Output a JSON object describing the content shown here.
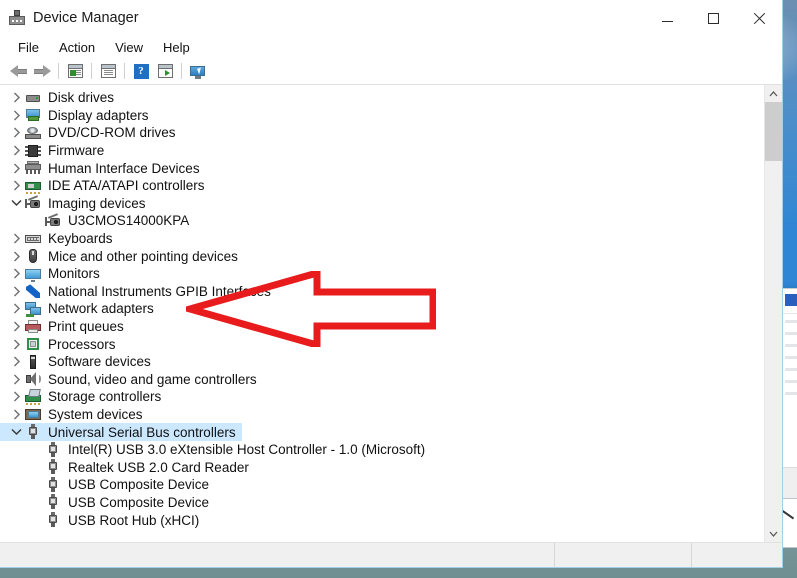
{
  "window": {
    "title": "Device Manager",
    "icon": "device-manager-icon",
    "controls": {
      "minimize": "minimize",
      "maximize": "maximize",
      "close": "close"
    }
  },
  "menubar": {
    "items": [
      {
        "label": "File"
      },
      {
        "label": "Action"
      },
      {
        "label": "View"
      },
      {
        "label": "Help"
      }
    ]
  },
  "toolbar": {
    "buttons": [
      {
        "name": "back-button",
        "icon": "arrow-left-icon"
      },
      {
        "name": "forward-button",
        "icon": "arrow-right-icon"
      },
      {
        "name": "show-hide-console-tree-button",
        "icon": "console-tree-icon"
      },
      {
        "name": "properties-button",
        "icon": "properties-icon"
      },
      {
        "name": "help-button",
        "icon": "help-icon"
      },
      {
        "name": "update-driver-button",
        "icon": "update-driver-icon"
      },
      {
        "name": "scan-for-hardware-changes-button",
        "icon": "scan-hardware-icon"
      }
    ],
    "help_glyph": "?"
  },
  "tree": {
    "items": [
      {
        "label": "Disk drives",
        "depth": 0,
        "expander": "collapsed",
        "icon": "disk-drive-icon",
        "selected": false
      },
      {
        "label": "Display adapters",
        "depth": 0,
        "expander": "collapsed",
        "icon": "display-adapter-icon",
        "selected": false
      },
      {
        "label": "DVD/CD-ROM drives",
        "depth": 0,
        "expander": "collapsed",
        "icon": "dvd-drive-icon",
        "selected": false
      },
      {
        "label": "Firmware",
        "depth": 0,
        "expander": "collapsed",
        "icon": "firmware-icon",
        "selected": false
      },
      {
        "label": "Human Interface Devices",
        "depth": 0,
        "expander": "collapsed",
        "icon": "hid-icon",
        "selected": false
      },
      {
        "label": "IDE ATA/ATAPI controllers",
        "depth": 0,
        "expander": "collapsed",
        "icon": "ide-controller-icon",
        "selected": false
      },
      {
        "label": "Imaging devices",
        "depth": 0,
        "expander": "expanded",
        "icon": "camera-icon",
        "selected": false
      },
      {
        "label": "U3CMOS14000KPA",
        "depth": 1,
        "expander": "none",
        "icon": "camera-icon",
        "selected": false
      },
      {
        "label": "Keyboards",
        "depth": 0,
        "expander": "collapsed",
        "icon": "keyboard-icon",
        "selected": false
      },
      {
        "label": "Mice and other pointing devices",
        "depth": 0,
        "expander": "collapsed",
        "icon": "mouse-icon",
        "selected": false
      },
      {
        "label": "Monitors",
        "depth": 0,
        "expander": "collapsed",
        "icon": "monitor-icon",
        "selected": false
      },
      {
        "label": "National Instruments GPIB Interfaces",
        "depth": 0,
        "expander": "collapsed",
        "icon": "national-instruments-icon",
        "selected": false
      },
      {
        "label": "Network adapters",
        "depth": 0,
        "expander": "collapsed",
        "icon": "network-adapter-icon",
        "selected": false
      },
      {
        "label": "Print queues",
        "depth": 0,
        "expander": "collapsed",
        "icon": "printer-icon",
        "selected": false
      },
      {
        "label": "Processors",
        "depth": 0,
        "expander": "collapsed",
        "icon": "processor-icon",
        "selected": false
      },
      {
        "label": "Software devices",
        "depth": 0,
        "expander": "collapsed",
        "icon": "software-device-icon",
        "selected": false
      },
      {
        "label": "Sound, video and game controllers",
        "depth": 0,
        "expander": "collapsed",
        "icon": "sound-icon",
        "selected": false
      },
      {
        "label": "Storage controllers",
        "depth": 0,
        "expander": "collapsed",
        "icon": "storage-controller-icon",
        "selected": false
      },
      {
        "label": "System devices",
        "depth": 0,
        "expander": "collapsed",
        "icon": "system-device-icon",
        "selected": false
      },
      {
        "label": "Universal Serial Bus controllers",
        "depth": 0,
        "expander": "expanded",
        "icon": "usb-icon",
        "selected": true
      },
      {
        "label": "Intel(R) USB 3.0 eXtensible Host Controller - 1.0 (Microsoft)",
        "depth": 1,
        "expander": "none",
        "icon": "usb-icon",
        "selected": false
      },
      {
        "label": "Realtek USB 2.0 Card Reader",
        "depth": 1,
        "expander": "none",
        "icon": "usb-icon",
        "selected": false
      },
      {
        "label": "USB Composite Device",
        "depth": 1,
        "expander": "none",
        "icon": "usb-icon",
        "selected": false
      },
      {
        "label": "USB Composite Device",
        "depth": 1,
        "expander": "none",
        "icon": "usb-icon",
        "selected": false
      },
      {
        "label": "USB Root Hub (xHCI)",
        "depth": 1,
        "expander": "none",
        "icon": "usb-icon",
        "selected": false
      }
    ]
  },
  "scrollbar": {
    "up_arrow": "scroll-up-icon",
    "down_arrow": "scroll-down-icon",
    "thumb_position_percent": 0,
    "thumb_size_percent": 14
  },
  "statusbar": {
    "main_text": "",
    "panel2_text": "",
    "panel3_text": ""
  },
  "annotation": {
    "type": "arrow",
    "direction": "left",
    "color": "#e81c1c",
    "points_at": "U3CMOS14000KPA"
  },
  "colors": {
    "selection": "#cce8ff",
    "annotation_red": "#e81c1c",
    "accent_blue": "#1f6fc4",
    "window_bg": "#ffffff",
    "statusbar_bg": "#f0f0f0"
  }
}
